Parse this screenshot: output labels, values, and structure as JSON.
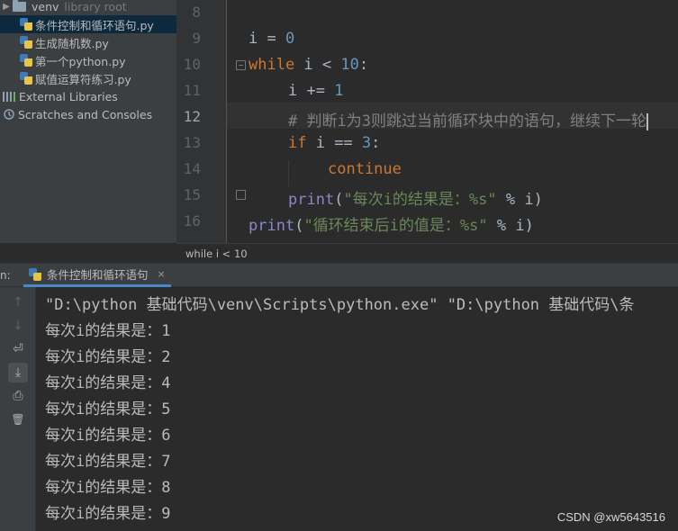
{
  "project_tree": {
    "venv_label": "venv",
    "venv_note": "library root",
    "files": [
      "条件控制和循环语句.py",
      "生成随机数.py",
      "第一个python.py",
      "赋值运算符练习.py"
    ],
    "external_libraries": "External Libraries",
    "scratches": "Scratches and Consoles"
  },
  "editor": {
    "line_numbers": [
      "8",
      "9",
      "10",
      "11",
      "12",
      "13",
      "14",
      "15",
      "16"
    ],
    "current_line": "12",
    "code": {
      "l9_var": "i",
      "l9_op": " = ",
      "l9_num": "0",
      "l10_kw": "while",
      "l10_rest": " i < ",
      "l10_num": "10",
      "l10_colon": ":",
      "l11_text": "i += ",
      "l11_num": "1",
      "l12_comment": "# 判断i为3则跳过当前循环块中的语句，继续下一轮",
      "l13_kw": "if",
      "l13_rest": " i == ",
      "l13_num": "3",
      "l13_colon": ":",
      "l14_kw": "continue",
      "l15_fn": "print",
      "l15_open": "(",
      "l15_str": "\"每次i的结果是：%s\"",
      "l15_rest": " % i)",
      "l16_fn": "print",
      "l16_open": "(",
      "l16_str": "\"循环结束后i的值是：%s\"",
      "l16_rest": " % i)"
    },
    "breadcrumb": "while i < 10"
  },
  "run_window": {
    "prefix": "n:",
    "tab_label": "条件控制和循环语句",
    "close_glyph": "×",
    "console_lines": [
      "\"D:\\python 基础代码\\venv\\Scripts\\python.exe\" \"D:\\python 基础代码\\条",
      "每次i的结果是：1",
      "每次i的结果是：2",
      "每次i的结果是：4",
      "每次i的结果是：5",
      "每次i的结果是：6",
      "每次i的结果是：7",
      "每次i的结果是：8",
      "每次i的结果是：9"
    ]
  },
  "toolbar_icons": {
    "up": "↑",
    "down": "↓",
    "wrap": "⏎",
    "scroll_end": "⤓",
    "print": "⎙",
    "trash": "🗑"
  },
  "watermark": "CSDN @xw5643516"
}
